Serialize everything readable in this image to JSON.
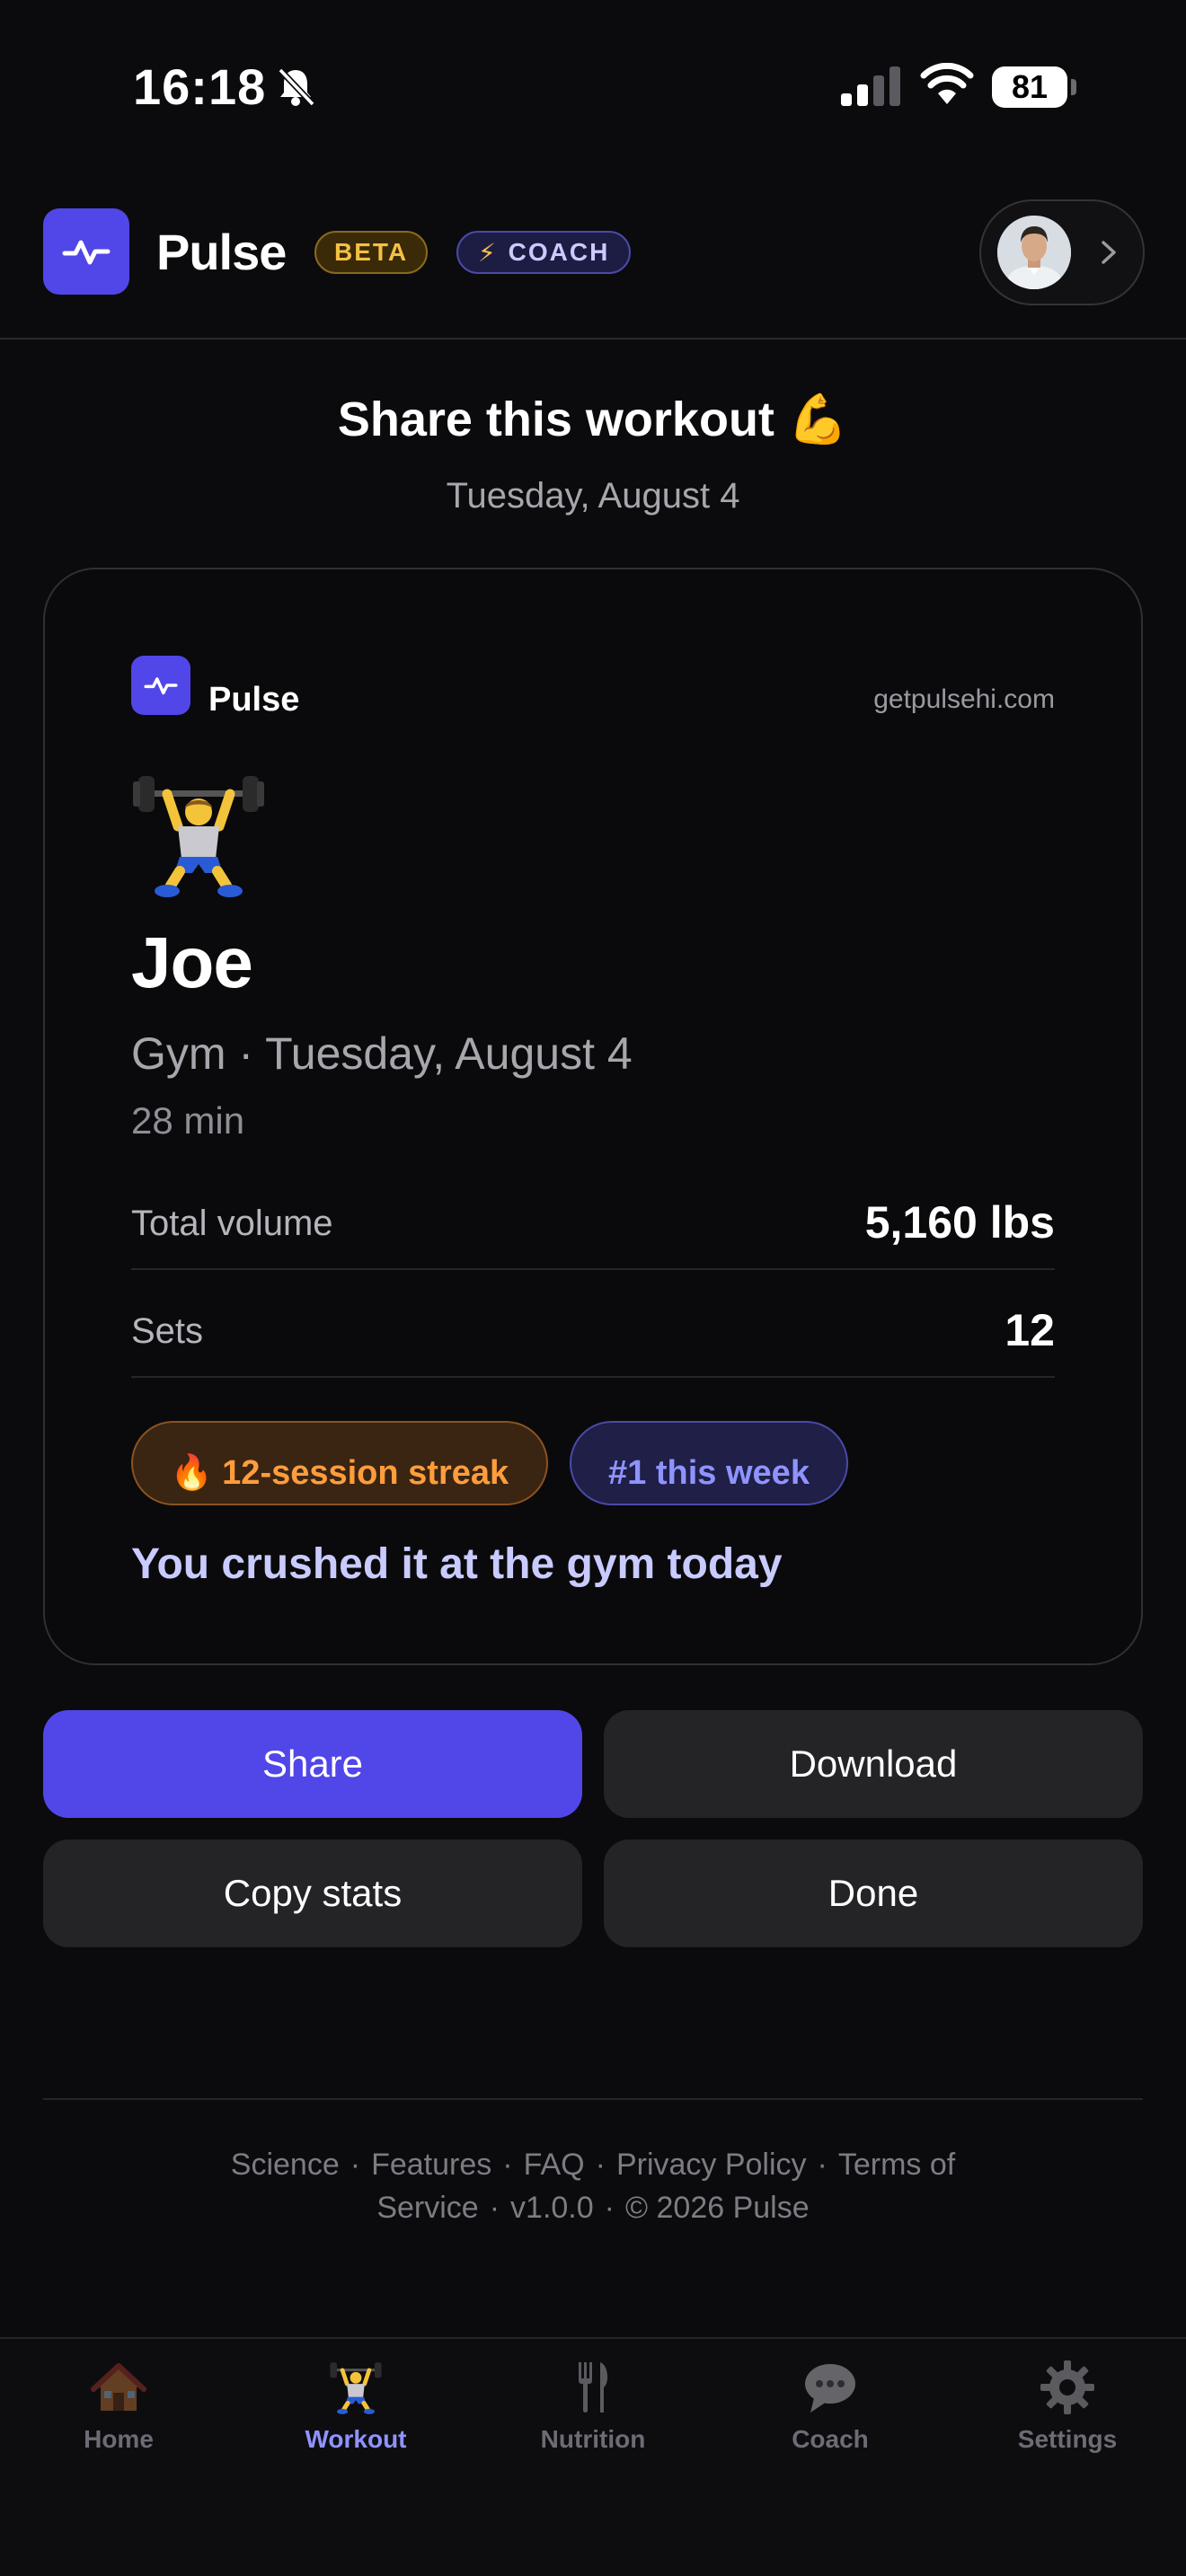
{
  "status_bar": {
    "time": "16:18",
    "battery": "81"
  },
  "header": {
    "app_name": "Pulse",
    "beta_badge": "BETA",
    "coach_badge": "COACH"
  },
  "share": {
    "title": "Share this workout 💪",
    "date": "Tuesday, August 4"
  },
  "card": {
    "app_name": "Pulse",
    "url": "getpulsehi.com",
    "name": "Joe",
    "subtitle": "Gym · Tuesday, August 4",
    "duration": "28 min",
    "stats": [
      {
        "label": "Total volume",
        "value": "5,160 lbs"
      },
      {
        "label": "Sets",
        "value": "12"
      }
    ],
    "streak_badge": "12-session streak",
    "rank_badge": "#1 this week",
    "tagline": "You crushed it at the gym today"
  },
  "actions": {
    "share": "Share",
    "download": "Download",
    "copy_stats": "Copy stats",
    "done": "Done"
  },
  "footer": {
    "links": [
      "Science",
      "Features",
      "FAQ",
      "Privacy Policy",
      "Terms of Service"
    ],
    "version": "v1.0.0",
    "copyright": "© 2026 Pulse"
  },
  "tabs": [
    {
      "label": "Home",
      "icon": "house-icon"
    },
    {
      "label": "Workout",
      "icon": "weightlifter-icon",
      "active": true
    },
    {
      "label": "Nutrition",
      "icon": "fork-knife-icon"
    },
    {
      "label": "Coach",
      "icon": "speech-bubble-icon"
    },
    {
      "label": "Settings",
      "icon": "gear-icon"
    }
  ],
  "colors": {
    "accent": "#5146e8",
    "background": "#0b0b0d",
    "beta": "#f5c044",
    "streak": "#ff9d3d",
    "rank": "#8f93ff"
  }
}
